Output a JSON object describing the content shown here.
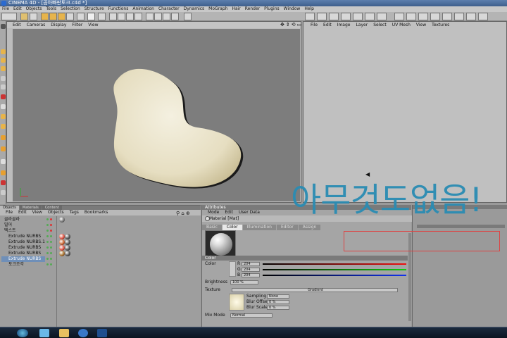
{
  "window": {
    "title": "CINEMA 4D - [곰아빠판토크.c4d *]"
  },
  "menubar": [
    "File",
    "Edit",
    "Objects",
    "Tools",
    "Selection",
    "Structure",
    "Functions",
    "Animation",
    "Character",
    "Dynamics",
    "MoGraph",
    "Hair",
    "Render",
    "Plugins",
    "Window",
    "Help"
  ],
  "viewport": {
    "menu": [
      "Edit",
      "Cameras",
      "Display",
      "Filter",
      "View"
    ]
  },
  "picture_viewer": {
    "menu": [
      "File",
      "Edit",
      "Image",
      "Layer",
      "Select",
      "UV Mesh",
      "View",
      "Textures"
    ]
  },
  "objects_panel": {
    "tabs": [
      "Objects",
      "Materials",
      "Content"
    ],
    "menu": [
      "File",
      "Edit",
      "View",
      "Objects",
      "Tags",
      "Bookmarks"
    ],
    "rows": [
      {
        "label": "골라골라"
      },
      {
        "label": "밀어"
      },
      {
        "label": "텍스트"
      },
      {
        "label": "Extrude NURBS"
      },
      {
        "label": "Extrude NURBS.1"
      },
      {
        "label": "Extrude NURBS"
      },
      {
        "label": "Extrude NURBS"
      },
      {
        "label": "Extrude NURBS"
      },
      {
        "label": "토크조각"
      }
    ]
  },
  "attributes_panel": {
    "tab": "Attributes",
    "menu": [
      "Mode",
      "Edit",
      "User Data"
    ],
    "material_label": "Material [Mat]",
    "subtabs": [
      "Basic",
      "Color",
      "Illumination",
      "Editor",
      "Assign"
    ],
    "section": "Color",
    "color_label": "Color",
    "r_label": "R",
    "g_label": "G",
    "b_label": "B",
    "r_value": "204",
    "g_value": "204",
    "b_value": "204",
    "brightness_label": "Brightness",
    "brightness_value": "100 %",
    "texture_label": "Texture",
    "texture_value": "Gradient",
    "sampling_label": "Sampling",
    "sampling_value": "None",
    "blur_offset_label": "Blur Offset",
    "blur_offset_value": "0 %",
    "blur_scale_label": "Blur Scale",
    "blur_scale_value": "0 %",
    "mix_mode_label": "Mix Mode",
    "mix_mode_value": "Normal"
  },
  "overlay": {
    "text": "아무것도없음!"
  },
  "colors": {
    "overlay": "#2a8cb3",
    "shape": "#e8e2c8",
    "redbox": "#d44444"
  }
}
